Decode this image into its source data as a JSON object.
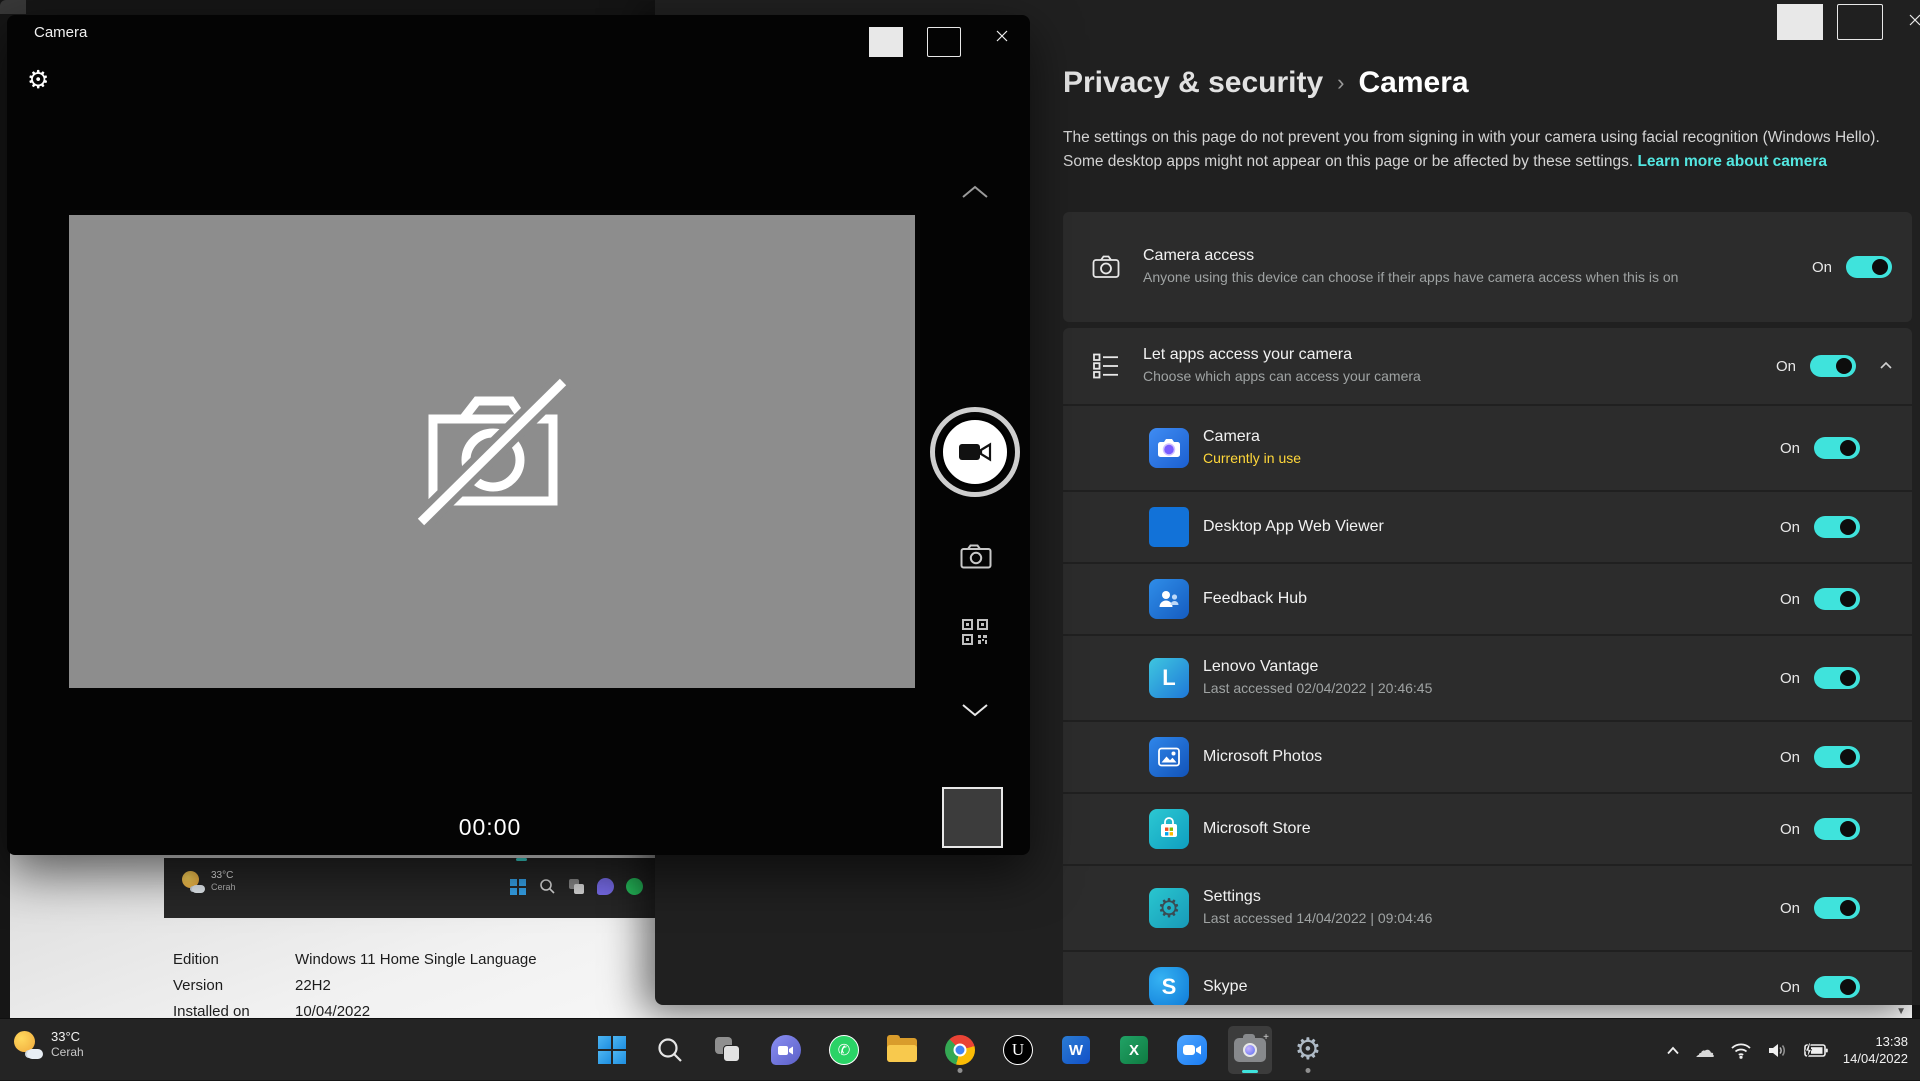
{
  "colors": {
    "accent": "#3fe3dc",
    "link": "#53e6e0",
    "warning": "#ffd73a"
  },
  "settings_window": {
    "breadcrumb": {
      "parent": "Privacy & security",
      "separator": "›",
      "current": "Camera"
    },
    "intro": {
      "text": "The settings on this page do not prevent you from signing in with your camera using facial recognition (Windows Hello). Some desktop apps might not appear on this page or be affected by these settings.",
      "link": "Learn more about camera"
    },
    "camera_access": {
      "title": "Camera access",
      "description": "Anyone using this device can choose if their apps have camera access when this is on",
      "state": "On"
    },
    "let_apps": {
      "title": "Let apps access your camera",
      "description": "Choose which apps can access your camera",
      "state": "On"
    },
    "apps": [
      {
        "name": "Camera",
        "status": "Currently in use",
        "state": "On"
      },
      {
        "name": "Desktop App Web Viewer",
        "status": "",
        "state": "On"
      },
      {
        "name": "Feedback Hub",
        "status": "",
        "state": "On"
      },
      {
        "name": "Lenovo Vantage",
        "status": "Last accessed 02/04/2022  |  20:46:45",
        "state": "On"
      },
      {
        "name": "Microsoft Photos",
        "status": "",
        "state": "On"
      },
      {
        "name": "Microsoft Store",
        "status": "",
        "state": "On"
      },
      {
        "name": "Settings",
        "status": "Last accessed 14/04/2022  |  09:04:46",
        "state": "On"
      },
      {
        "name": "Skype",
        "status": "",
        "state": "On"
      }
    ]
  },
  "camera_app": {
    "title": "Camera",
    "timer": "00:00"
  },
  "about_page": {
    "rows": [
      {
        "label": "Edition",
        "value": "Windows 11 Home Single Language"
      },
      {
        "label": "Version",
        "value": "22H2"
      },
      {
        "label": "Installed on",
        "value": "10/04/2022"
      }
    ],
    "taskbar_image_weather": {
      "temp": "33°C",
      "condition": "Cerah"
    }
  },
  "taskbar": {
    "weather": {
      "temp": "33°C",
      "condition": "Cerah"
    },
    "clock": {
      "time": "13:38",
      "date": "14/04/2022"
    }
  }
}
